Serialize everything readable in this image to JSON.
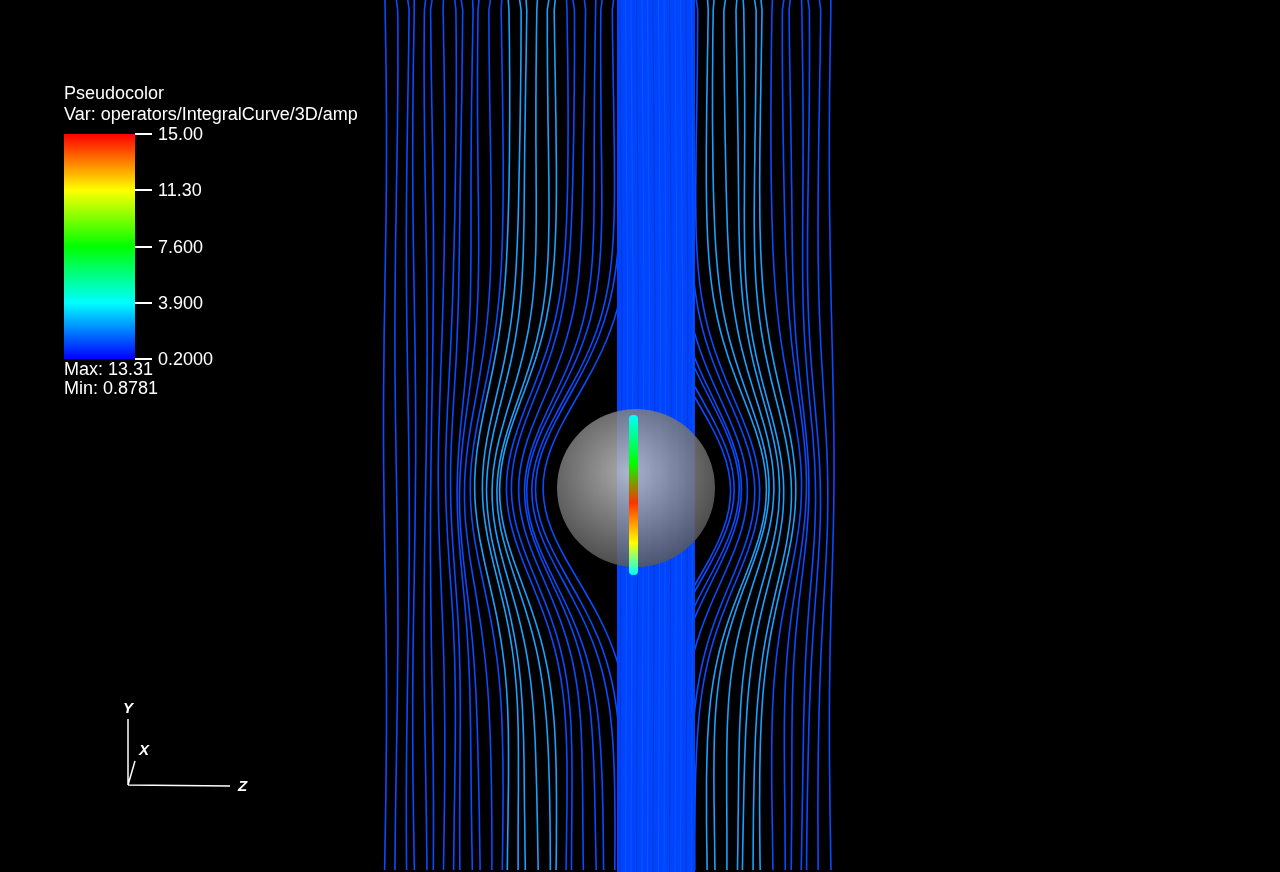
{
  "legend": {
    "title": "Pseudocolor",
    "variable": "Var: operators/IntegralCurve/3D/amp",
    "ticks": [
      "15.00",
      "11.30",
      "7.600",
      "3.900",
      "0.2000"
    ],
    "max": "Max:  13.31",
    "min": "Min:  0.8781"
  },
  "axes": [
    {
      "label": "Y"
    },
    {
      "label": "X"
    },
    {
      "label": "Z"
    }
  ]
}
